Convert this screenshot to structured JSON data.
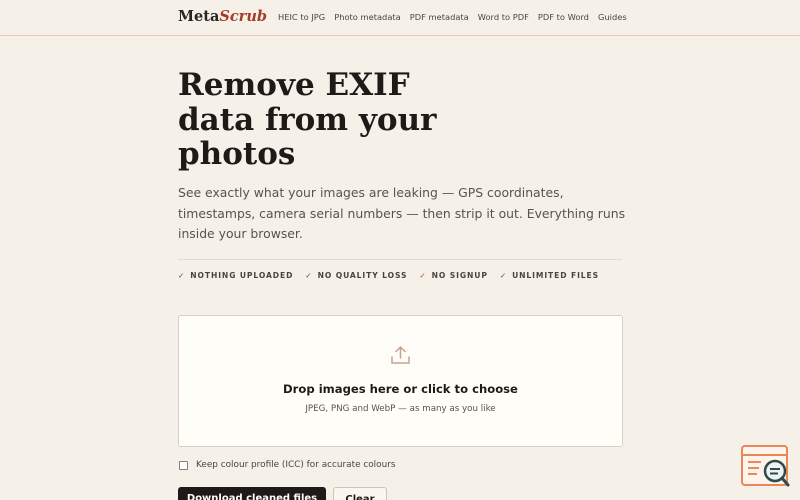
{
  "header": {
    "logo_main": "Meta",
    "logo_accent": "Scrub",
    "nav": [
      "HEIC to JPG",
      "Photo metadata",
      "PDF metadata",
      "Word to PDF",
      "PDF to Word",
      "Guides"
    ]
  },
  "hero": {
    "title_lines": [
      "Remove EXIF",
      "data from your",
      "photos"
    ],
    "subtitle": "See exactly what your images are leaking — GPS coordinates, timestamps, camera serial numbers — then strip it out. Everything runs inside your browser."
  },
  "features": [
    {
      "label": "NOTHING UPLOADED",
      "check": "✓",
      "check_color": "#5a524c"
    },
    {
      "label": "NO QUALITY LOSS",
      "check": "✓",
      "check_color": "#5a524c"
    },
    {
      "label": "NO SIGNUP",
      "check": "✓",
      "check_color": "#c04030"
    },
    {
      "label": "UNLIMITED FILES",
      "check": "✓",
      "check_color": "#5a524c"
    }
  ],
  "dropzone": {
    "icon": "upload-icon",
    "title": "Drop images here or click to choose",
    "subtitle": "JPEG, PNG and WebP — as many as you like"
  },
  "options": {
    "keep_icc_label": "Keep colour profile (ICC) for accurate colours",
    "keep_icc_checked": false
  },
  "actions": {
    "download_label": "Download cleaned files",
    "clear_label": "Clear"
  },
  "colors": {
    "background": "#f5f1e9",
    "accent": "#a83a2a",
    "text": "#1f1a17",
    "widget": "#e8875a"
  },
  "widget": {
    "icon": "search-chat-icon"
  }
}
